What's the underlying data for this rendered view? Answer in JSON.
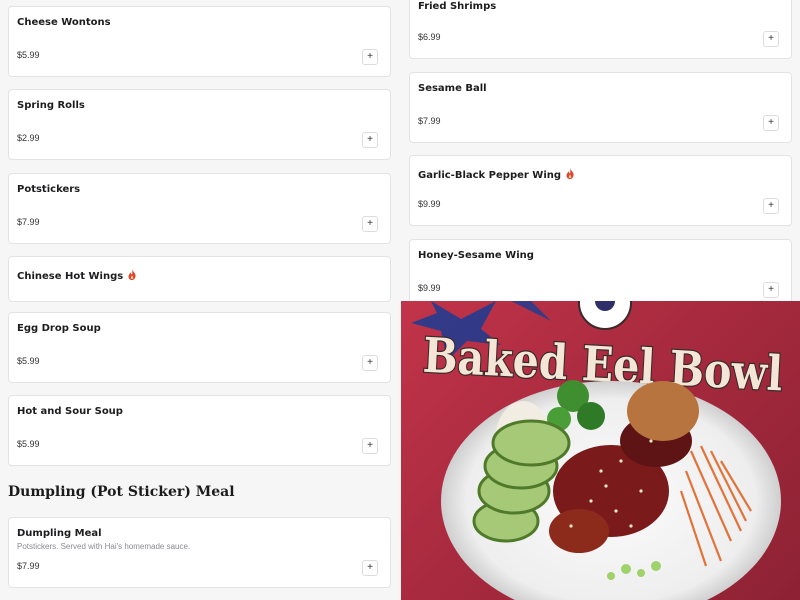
{
  "left_items": [
    {
      "name": "Cheese Wontons",
      "price": "$5.99",
      "spicy": false
    },
    {
      "name": "Spring Rolls",
      "price": "$2.99",
      "spicy": false
    },
    {
      "name": "Potstickers",
      "price": "$7.99",
      "spicy": false
    },
    {
      "name": "Chinese Hot Wings",
      "price": "",
      "spicy": true
    },
    {
      "name": "Egg Drop Soup",
      "price": "$5.99",
      "spicy": false
    },
    {
      "name": "Hot and Sour Soup",
      "price": "$5.99",
      "spicy": false
    }
  ],
  "right_items": [
    {
      "name": "Fried Shrimps",
      "price": "$6.99",
      "spicy": false
    },
    {
      "name": "Sesame Ball",
      "price": "$7.99",
      "spicy": false
    },
    {
      "name": "Garlic-Black Pepper Wing",
      "price": "$9.99",
      "spicy": true
    },
    {
      "name": "Honey-Sesame Wing",
      "price": "$9.99",
      "spicy": false
    }
  ],
  "section": {
    "title": "Dumpling (Pot Sticker) Meal",
    "item": {
      "name": "Dumpling Meal",
      "description": "Potstickers. Served with Hai's homemade sauce.",
      "price": "$7.99"
    }
  },
  "add_label": "+",
  "photo": {
    "caption": "Baked Eel Bowl",
    "colors": {
      "background": "#b22d42",
      "caption_fill": "#f4e6d6",
      "caption_outline": "#3a2a2a"
    }
  },
  "colors": {
    "spicy_icon": "#e0452b"
  }
}
